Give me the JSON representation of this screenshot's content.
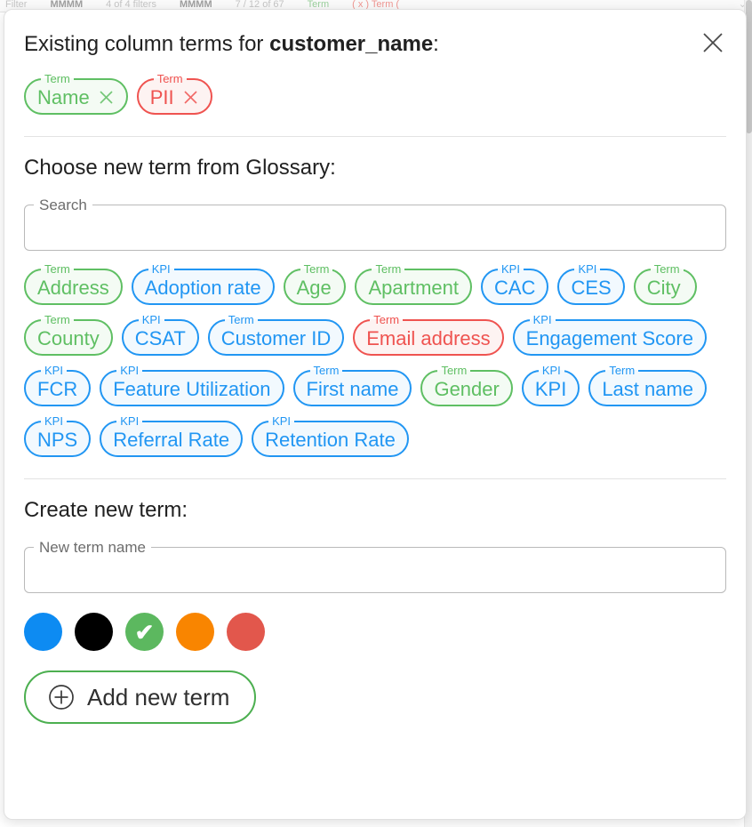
{
  "backdrop": {
    "fragments": [
      {
        "text": "Filter",
        "style": "dim"
      },
      {
        "text": "MMMM",
        "style": "strong"
      },
      {
        "text": "4 of 4 filters",
        "style": "dim"
      },
      {
        "text": "MMMM",
        "style": "strong"
      },
      {
        "text": "7 / 12 of 67",
        "style": "dim"
      },
      {
        "text": "Term",
        "style": "green"
      },
      {
        "text": "( x ) Term (",
        "style": "red"
      }
    ],
    "caret": "⌄"
  },
  "dialog": {
    "close_icon": "close-icon",
    "existing": {
      "title_prefix": "Existing column terms for ",
      "column_name": "customer_name",
      "title_suffix": ":",
      "chips": [
        {
          "kind": "Term",
          "label": "Name",
          "color": "green",
          "removable": true
        },
        {
          "kind": "Term",
          "label": "PII",
          "color": "red",
          "removable": true
        }
      ]
    },
    "glossary": {
      "title": "Choose new term from Glossary:",
      "search": {
        "label": "Search",
        "value": "",
        "placeholder": ""
      },
      "chips": [
        {
          "kind": "Term",
          "label": "Address",
          "color": "green"
        },
        {
          "kind": "KPI",
          "label": "Adoption rate",
          "color": "blue"
        },
        {
          "kind": "Term",
          "label": "Age",
          "color": "green"
        },
        {
          "kind": "Term",
          "label": "Apartment",
          "color": "green"
        },
        {
          "kind": "KPI",
          "label": "CAC",
          "color": "blue"
        },
        {
          "kind": "KPI",
          "label": "CES",
          "color": "blue"
        },
        {
          "kind": "Term",
          "label": "City",
          "color": "green"
        },
        {
          "kind": "Term",
          "label": "County",
          "color": "green"
        },
        {
          "kind": "KPI",
          "label": "CSAT",
          "color": "blue"
        },
        {
          "kind": "Term",
          "label": "Customer ID",
          "color": "blue"
        },
        {
          "kind": "Term",
          "label": "Email address",
          "color": "red"
        },
        {
          "kind": "KPI",
          "label": "Engagement Score",
          "color": "blue"
        },
        {
          "kind": "KPI",
          "label": "FCR",
          "color": "blue"
        },
        {
          "kind": "KPI",
          "label": "Feature Utilization",
          "color": "blue"
        },
        {
          "kind": "Term",
          "label": "First name",
          "color": "blue"
        },
        {
          "kind": "Term",
          "label": "Gender",
          "color": "green"
        },
        {
          "kind": "KPI",
          "label": "KPI",
          "color": "blue"
        },
        {
          "kind": "Term",
          "label": "Last name",
          "color": "blue"
        },
        {
          "kind": "KPI",
          "label": "NPS",
          "color": "blue"
        },
        {
          "kind": "KPI",
          "label": "Referral Rate",
          "color": "blue"
        },
        {
          "kind": "KPI",
          "label": "Retention Rate",
          "color": "blue"
        }
      ]
    },
    "create": {
      "title": "Create new term:",
      "name_field": {
        "label": "New term name",
        "value": "",
        "placeholder": ""
      },
      "swatches": [
        {
          "name": "blue",
          "hex": "#0d8bf2",
          "selected": false
        },
        {
          "name": "black",
          "hex": "#000000",
          "selected": false
        },
        {
          "name": "green",
          "hex": "#5cb85f",
          "selected": true
        },
        {
          "name": "orange",
          "hex": "#f98500",
          "selected": false
        },
        {
          "name": "red",
          "hex": "#e2574c",
          "selected": false
        }
      ],
      "selected_mark": "✔",
      "add_button": {
        "label": "Add new term",
        "icon": "plus-circle-icon"
      }
    }
  }
}
